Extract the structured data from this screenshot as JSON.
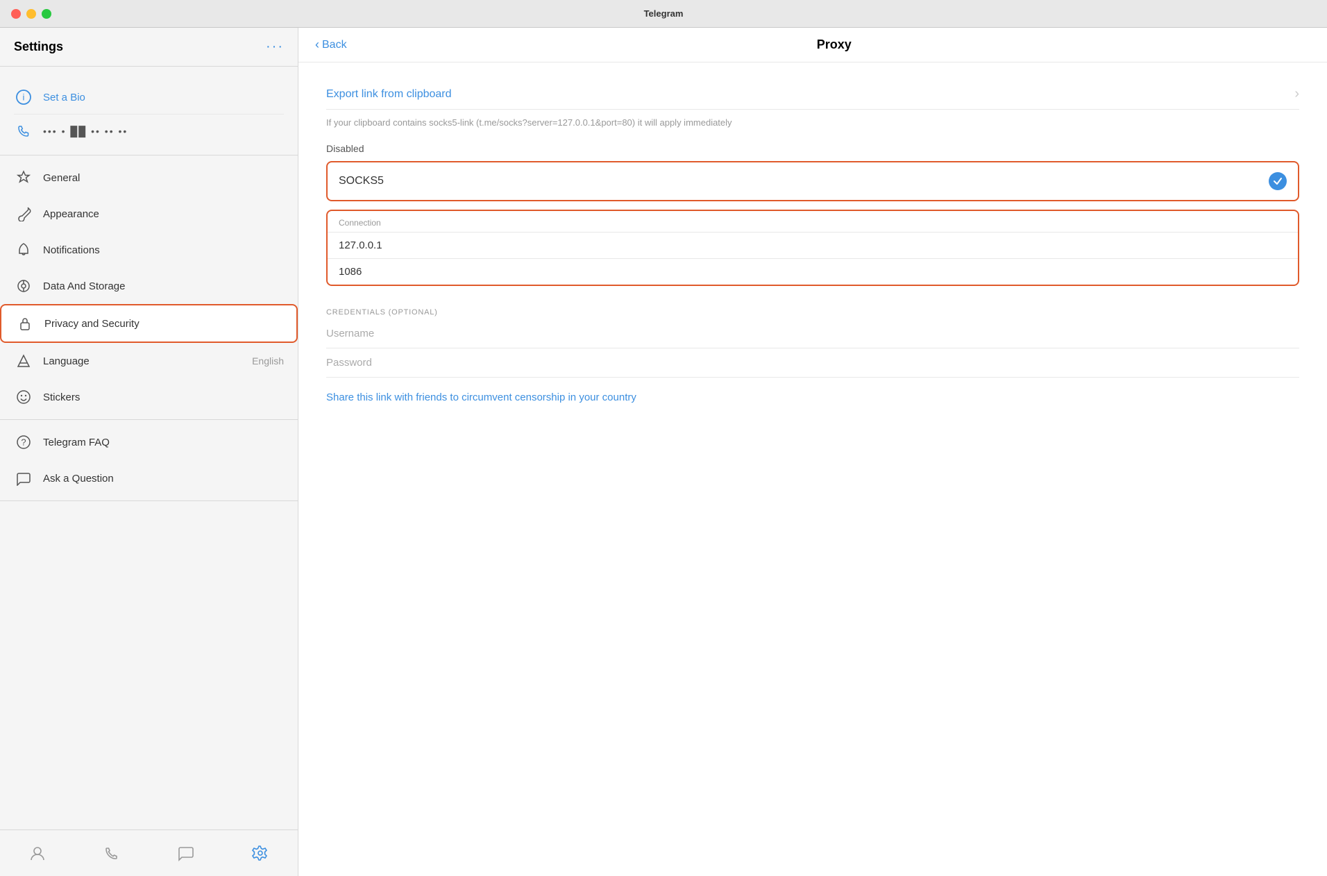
{
  "app": {
    "title": "Telegram"
  },
  "titlebar": {
    "title": "Telegram"
  },
  "sidebar": {
    "title": "Settings",
    "more_label": "···",
    "profile": {
      "bio_label": "Set a Bio",
      "phone": "•••  • ██ •• •• ••"
    },
    "items": [
      {
        "id": "general",
        "label": "General",
        "value": "",
        "icon": "general"
      },
      {
        "id": "appearance",
        "label": "Appearance",
        "value": "",
        "icon": "appearance"
      },
      {
        "id": "notifications",
        "label": "Notifications",
        "value": "",
        "icon": "notifications"
      },
      {
        "id": "data-storage",
        "label": "Data And Storage",
        "value": "",
        "icon": "data-storage"
      },
      {
        "id": "privacy-security",
        "label": "Privacy and Security",
        "value": "",
        "icon": "privacy",
        "active": true
      },
      {
        "id": "language",
        "label": "Language",
        "value": "English",
        "icon": "language"
      },
      {
        "id": "stickers",
        "label": "Stickers",
        "value": "",
        "icon": "stickers"
      }
    ],
    "bottom_items": [
      {
        "id": "faq",
        "label": "Telegram FAQ",
        "icon": "faq"
      },
      {
        "id": "ask",
        "label": "Ask a Question",
        "icon": "ask"
      }
    ],
    "nav": [
      {
        "id": "contacts",
        "icon": "person",
        "active": false
      },
      {
        "id": "calls",
        "icon": "phone",
        "active": false
      },
      {
        "id": "chats",
        "icon": "chat",
        "active": false
      },
      {
        "id": "settings",
        "icon": "gear",
        "active": true
      }
    ]
  },
  "content": {
    "back_label": "Back",
    "title": "Proxy",
    "export_link": {
      "label": "Export link from clipboard",
      "description": "If your clipboard contains socks5-link (t.me/socks?server=127.0.0.1&port=80) it will apply immediately"
    },
    "disabled_label": "Disabled",
    "socks5_label": "SOCKS5",
    "connection": {
      "label": "Connection",
      "server": "127.0.0.1",
      "port": "1086"
    },
    "credentials": {
      "label": "CREDENTIALS (OPTIONAL)",
      "username_placeholder": "Username",
      "password_placeholder": "Password"
    },
    "share_link": "Share this link with friends to circumvent censorship in your country"
  }
}
